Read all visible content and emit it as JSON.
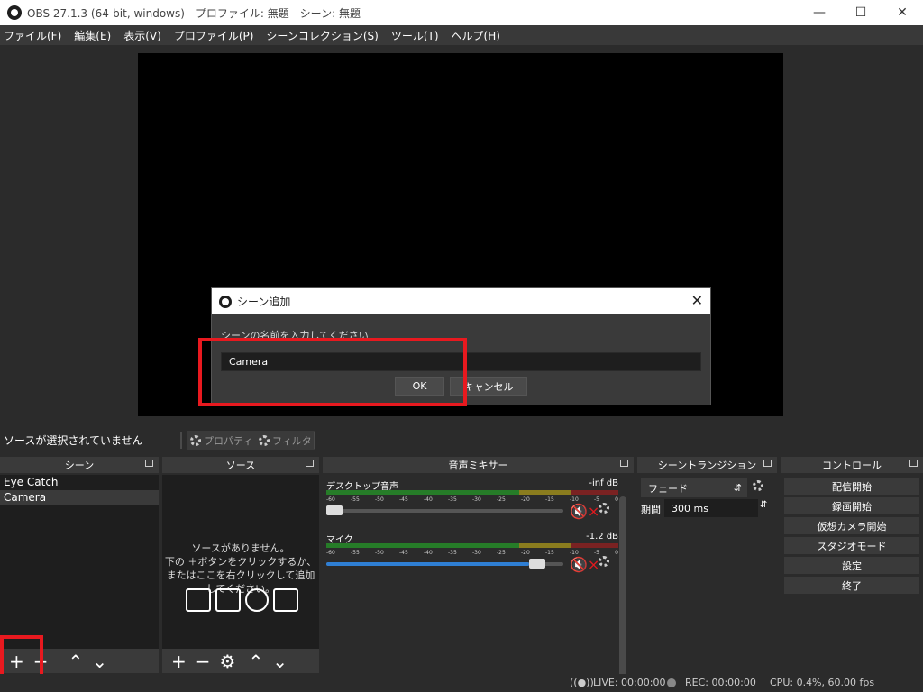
{
  "window": {
    "title": "OBS 27.1.3 (64-bit, windows) - プロファイル: 無題 - シーン: 無題"
  },
  "menu": [
    "ファイル(F)",
    "編集(E)",
    "表示(V)",
    "プロファイル(P)",
    "シーンコレクション(S)",
    "ツール(T)",
    "ヘルプ(H)"
  ],
  "dialog": {
    "title": "シーン追加",
    "prompt": "シーンの名前を入力してください",
    "value": "Camera",
    "ok_label": "OK",
    "cancel_label": "キャンセル"
  },
  "source_toolbar": {
    "no_source": "ソースが選択されていません",
    "properties_label": "プロパティ",
    "filters_label": "フィルタ"
  },
  "scenes": {
    "title": "シーン",
    "items": [
      "Eye Catch",
      "Camera"
    ],
    "selected": "Camera"
  },
  "sources": {
    "title": "ソース",
    "empty_text_1": "ソースがありません。",
    "empty_text_2": "下の ＋ボタンをクリックするか、",
    "empty_text_3": "またはここを右クリックして追加してください。"
  },
  "mixer": {
    "title": "音声ミキサー",
    "ticks": [
      "-60",
      "-55",
      "-50",
      "-45",
      "-40",
      "-35",
      "-30",
      "-25",
      "-20",
      "-15",
      "-10",
      "-5",
      "0"
    ],
    "channels": [
      {
        "name": "デスクトップ音声",
        "db": "-inf dB",
        "volume": 0.0,
        "muted": true
      },
      {
        "name": "マイク",
        "db": "-1.2 dB",
        "volume": 0.92,
        "muted": true
      }
    ]
  },
  "transition": {
    "title": "シーントランジション",
    "selected": "フェード",
    "duration_label": "期間",
    "duration_value": "300 ms"
  },
  "controls": {
    "title": "コントロール",
    "buttons": [
      "配信開始",
      "録画開始",
      "仮想カメラ開始",
      "スタジオモード",
      "設定",
      "終了"
    ]
  },
  "status": {
    "live": "LIVE: 00:00:00",
    "rec": "REC: 00:00:00",
    "cpu": "CPU: 0.4%, 60.00 fps"
  },
  "colors": {
    "accent_red": "#e8191f",
    "slider_blue": "#2f7fd4"
  }
}
